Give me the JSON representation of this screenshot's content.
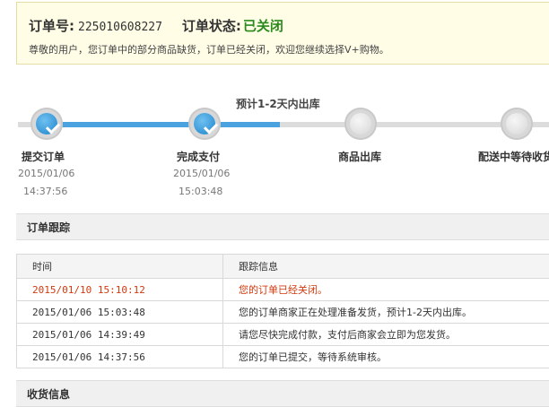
{
  "order": {
    "number_label": "订单号:",
    "number": "225010608227",
    "status_label": "订单状态:",
    "status_value": "已关闭",
    "status_color": "#2a8a1e",
    "message": "尊敬的用户，您订单中的部分商品缺货，订单已经关闭，欢迎您继续选择V+购物。"
  },
  "progress": {
    "hint": "预计1-2天内出库",
    "steps": [
      {
        "label": "提交订单",
        "date": "2015/01/06",
        "time": "14:37:56",
        "done": true
      },
      {
        "label": "完成支付",
        "date": "2015/01/06",
        "time": "15:03:48",
        "done": true
      },
      {
        "label": "商品出库",
        "date": "",
        "time": "",
        "done": false
      },
      {
        "label": "配送中等待收货",
        "date": "",
        "time": "",
        "done": false
      }
    ]
  },
  "tracking": {
    "title": "订单跟踪",
    "columns": [
      "时间",
      "跟踪信息"
    ],
    "rows": [
      {
        "time": "2015/01/10 15:10:12",
        "info": "您的订单已经关闭。"
      },
      {
        "time": "2015/01/06 15:03:48",
        "info": "您的订单商家正在处理准备发货，预计1-2天内出库。"
      },
      {
        "time": "2015/01/06 14:39:49",
        "info": "请您尽快完成付款，支付后商家会立即为您发货。"
      },
      {
        "time": "2015/01/06 14:37:56",
        "info": "您的订单已提交，等待系统审核。"
      }
    ]
  },
  "shipping": {
    "title": "收货信息"
  }
}
